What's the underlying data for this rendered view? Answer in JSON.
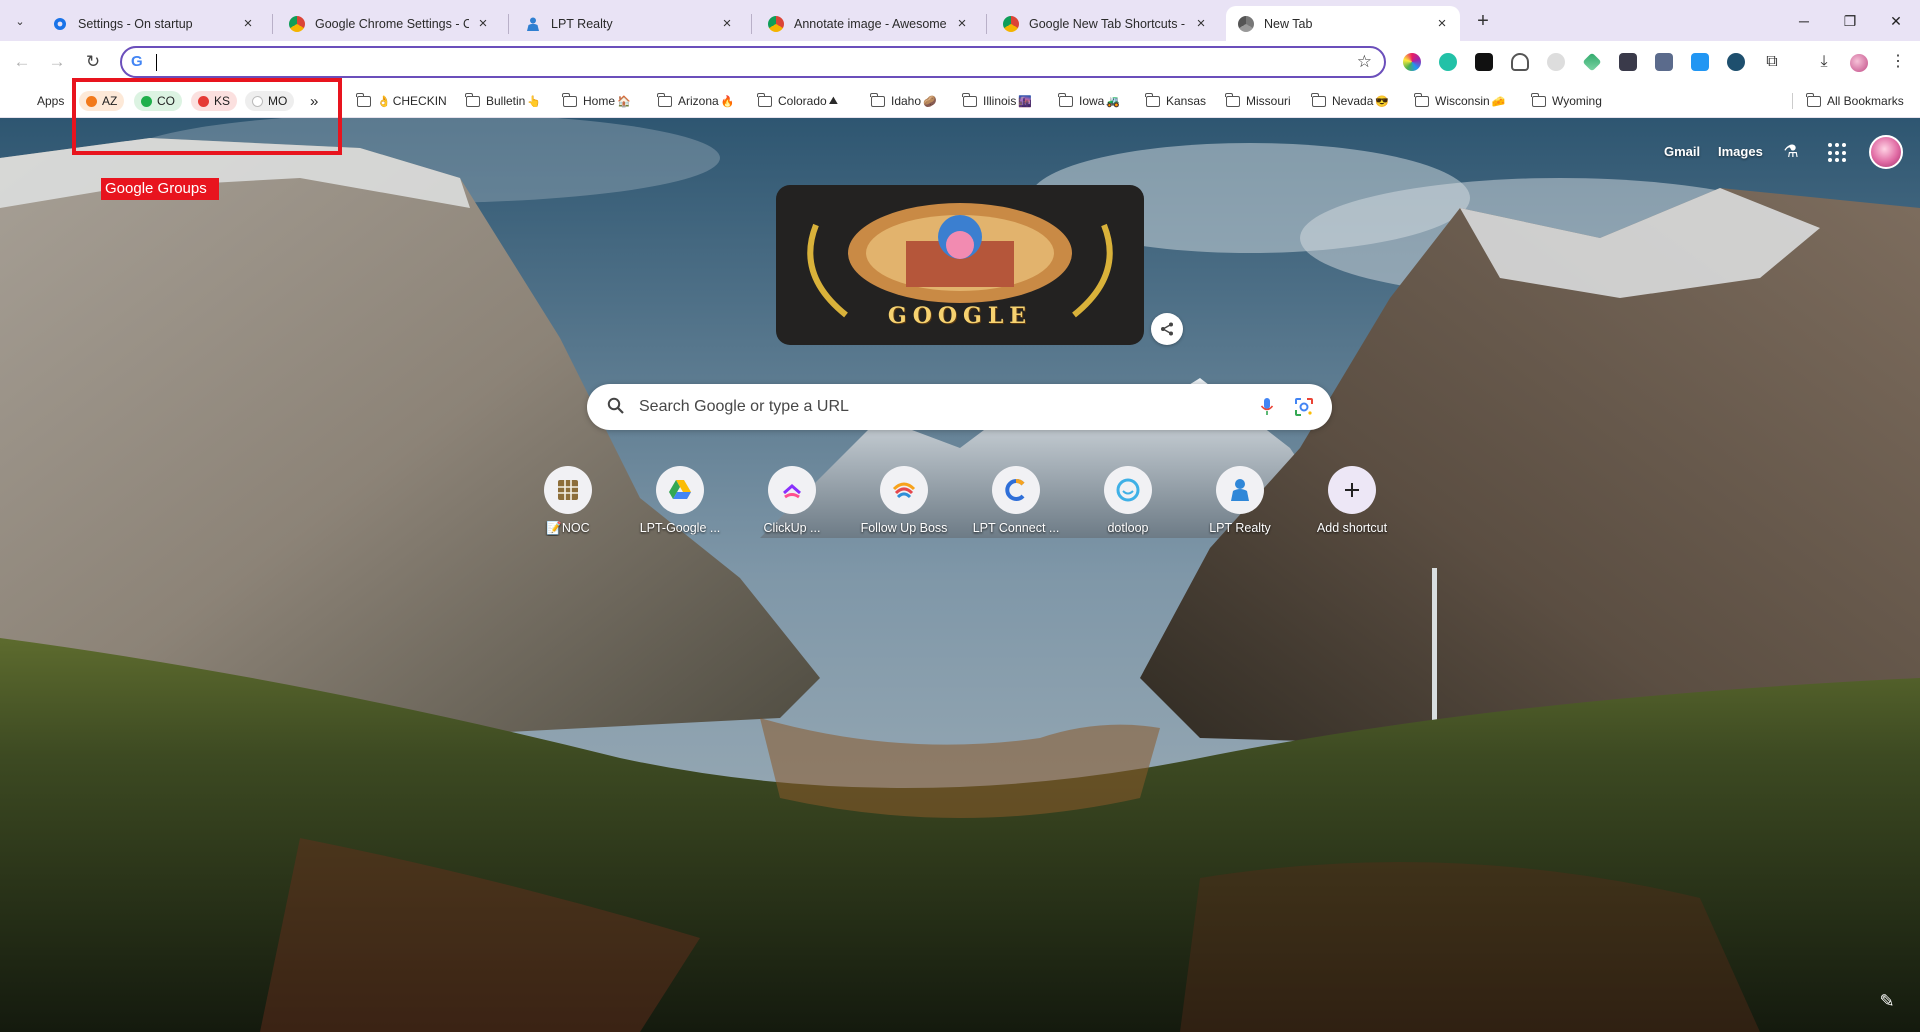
{
  "tabs": [
    {
      "title": "Settings - On startup",
      "active": false,
      "icon": "gear-icon"
    },
    {
      "title": "Google Chrome Settings - On s",
      "active": false,
      "icon": "chrome-icon"
    },
    {
      "title": "LPT Realty",
      "active": false,
      "icon": "person-icon"
    },
    {
      "title": "Annotate image - Awesome Sc",
      "active": false,
      "icon": "chrome-icon"
    },
    {
      "title": "Google New Tab Shortcuts - Aw",
      "active": false,
      "icon": "chrome-icon"
    },
    {
      "title": "New Tab",
      "active": true,
      "icon": "chrome-icon"
    }
  ],
  "omnibox": {
    "value": "",
    "engine_icon": "G"
  },
  "bookmarks": {
    "apps_label": "Apps",
    "groups": [
      {
        "label": "AZ",
        "color": "#f2791b",
        "bg": "#fde9d8"
      },
      {
        "label": "CO",
        "color": "#1faf4b",
        "bg": "#dcf3e2"
      },
      {
        "label": "KS",
        "color": "#e53935",
        "bg": "#fbe0df"
      },
      {
        "label": "MO",
        "color": "#ffffff",
        "bg": "#eeeeee"
      }
    ],
    "overflow_label": "»",
    "folders": [
      {
        "label": "CHECKIN",
        "prefix_emoji": "👌"
      },
      {
        "label": "Bulletin",
        "emoji": "👆"
      },
      {
        "label": "Home",
        "emoji": "🏠"
      },
      {
        "label": "Arizona",
        "emoji": "🔥"
      },
      {
        "label": "Colorado",
        "emoji": "⛰"
      },
      {
        "label": "Idaho",
        "emoji": "🥔"
      },
      {
        "label": "Illinois",
        "emoji": "🌆"
      },
      {
        "label": "Iowa",
        "emoji": "🚜"
      },
      {
        "label": "Kansas",
        "emoji": ""
      },
      {
        "label": "Missouri",
        "emoji": ""
      },
      {
        "label": "Nevada",
        "emoji": "😎"
      },
      {
        "label": "Wisconsin",
        "emoji": "🧀"
      },
      {
        "label": "Wyoming",
        "emoji": ""
      }
    ],
    "all_bookmarks_label": "All Bookmarks"
  },
  "ntp": {
    "gmail_label": "Gmail",
    "images_label": "Images",
    "doodle_text": "GOOGLE",
    "search_placeholder": "Search Google or type a URL",
    "shortcuts": [
      {
        "label": "📝NOC",
        "icon": "sheets-grid-icon"
      },
      {
        "label": "LPT-Google ...",
        "icon": "google-drive-icon"
      },
      {
        "label": "ClickUp ...",
        "icon": "clickup-icon"
      },
      {
        "label": "Follow Up Boss",
        "icon": "follow-up-boss-icon"
      },
      {
        "label": "LPT Connect ...",
        "icon": "lpt-connect-icon"
      },
      {
        "label": "dotloop",
        "icon": "dotloop-icon"
      },
      {
        "label": "LPT Realty",
        "icon": "person-icon"
      },
      {
        "label": "Add shortcut",
        "icon": "plus-icon"
      }
    ]
  },
  "annotation": {
    "label": "Google Groups",
    "color": "#e8141e"
  }
}
